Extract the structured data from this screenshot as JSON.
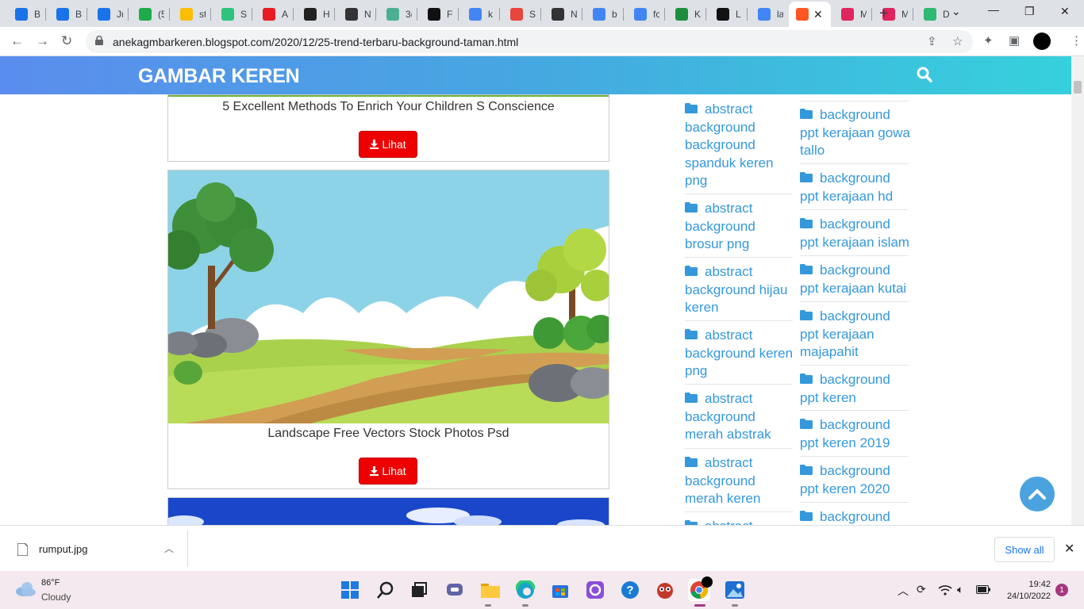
{
  "browser": {
    "tabs": [
      {
        "label": "B",
        "icon": "c-circle-icon",
        "color": "#1a73e8"
      },
      {
        "label": "B",
        "icon": "c-circle-icon",
        "color": "#1a73e8"
      },
      {
        "label": "Ju",
        "icon": "c-circle-icon",
        "color": "#1a73e8"
      },
      {
        "label": "(5",
        "icon": "55-icon",
        "color": "#1faa4b"
      },
      {
        "label": "st",
        "icon": "drive-icon",
        "color": "#fbbc04"
      },
      {
        "label": "Sc",
        "icon": "v-icon",
        "color": "#2ec27e"
      },
      {
        "label": "A",
        "icon": "adobe-icon",
        "color": "#e81b23"
      },
      {
        "label": "H",
        "icon": "st-icon",
        "color": "#222222"
      },
      {
        "label": "N",
        "icon": "github-icon",
        "color": "#333333"
      },
      {
        "label": "3(",
        "icon": "d-icon",
        "color": "#4caf93"
      },
      {
        "label": "F",
        "icon": "s-square-icon",
        "color": "#111111"
      },
      {
        "label": "k",
        "icon": "google-icon",
        "color": "#4285f4"
      },
      {
        "label": "S",
        "icon": "chat-icon",
        "color": "#e8453c"
      },
      {
        "label": "N",
        "icon": "github-icon",
        "color": "#333333"
      },
      {
        "label": "b",
        "icon": "google-icon",
        "color": "#4285f4"
      },
      {
        "label": "fc",
        "icon": "google-icon",
        "color": "#4285f4"
      },
      {
        "label": "K",
        "icon": "px-icon",
        "color": "#1e8e3e"
      },
      {
        "label": "L",
        "icon": "s-square-icon",
        "color": "#111111"
      },
      {
        "label": "la",
        "icon": "google-icon",
        "color": "#4285f4"
      },
      {
        "label": "",
        "icon": "blogger-icon",
        "color": "#ff5722",
        "active": true
      },
      {
        "label": "M",
        "icon": "shield-icon",
        "color": "#e0245e"
      },
      {
        "label": "M",
        "icon": "shield-icon",
        "color": "#e0245e"
      },
      {
        "label": "D",
        "icon": "shield-check-icon",
        "color": "#2eb872"
      }
    ],
    "new_tab": "+",
    "url": "anekagmbarkeren.blogspot.com/2020/12/25-trend-terbaru-background-taman.html"
  },
  "site": {
    "title": "GAMBAR KEREN",
    "cards": [
      {
        "caption": "5 Excellent Methods To Enrich Your Children S Conscience",
        "button": "Lihat"
      },
      {
        "caption": "Landscape Free Vectors Stock Photos Psd",
        "button": "Lihat"
      }
    ],
    "sidebar_left": [
      "abstract background background spanduk keren png",
      "abstract background brosur png",
      "abstract background hijau keren",
      "abstract background keren png",
      "abstract background merah abstrak",
      "abstract background merah keren",
      "abstract"
    ],
    "sidebar_left_lines": [
      [
        "abstract",
        "background",
        "background",
        "spanduk keren",
        "png"
      ],
      [
        "abstract",
        "background",
        "brosur png"
      ],
      [
        "abstract",
        "background hijau",
        "keren"
      ],
      [
        "abstract",
        "background keren",
        "png"
      ],
      [
        "abstract",
        "background",
        "merah abstrak"
      ],
      [
        "abstract",
        "background",
        "merah keren"
      ],
      [
        "abstract"
      ]
    ],
    "sidebar_right_lines": [
      [
        "background",
        "ppt kerajaan gowa",
        "tallo"
      ],
      [
        "background",
        "ppt kerajaan hd"
      ],
      [
        "background",
        "ppt kerajaan islam"
      ],
      [
        "background",
        "ppt kerajaan kutai"
      ],
      [
        "background",
        "ppt kerajaan",
        "majapahit"
      ],
      [
        "background",
        "ppt keren"
      ],
      [
        "background",
        "ppt keren 2019"
      ],
      [
        "background",
        "ppt keren 2020"
      ],
      [
        "background"
      ]
    ]
  },
  "downloads": {
    "file": "rumput.jpg",
    "show_all": "Show all"
  },
  "taskbar": {
    "temperature": "86°F",
    "condition": "Cloudy",
    "time": "19:42",
    "date": "24/10/2022",
    "notifications": "1"
  }
}
